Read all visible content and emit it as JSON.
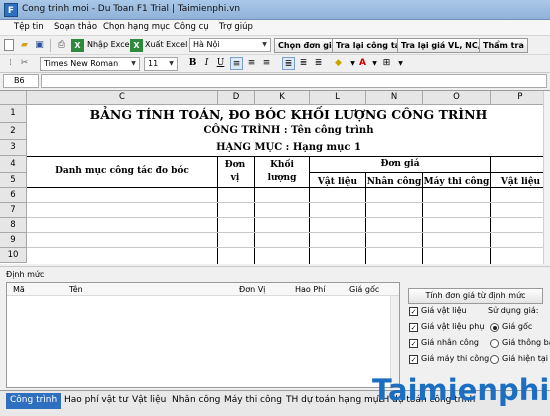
{
  "window": {
    "title": "Cong trinh moi - Du Toan F1 Trial | Taimienphi.vn",
    "app_icon": "F"
  },
  "menu": [
    "Tệp tin",
    "Soạn thảo",
    "Chọn hạng mục",
    "Công cụ",
    "Trợ giúp"
  ],
  "toolbar1": {
    "import_label": "Nhập Excel",
    "export_label": "Xuất Excel",
    "region": "Hà Nội",
    "btn_price": "Chọn đơn giá",
    "btn_check": "Tra lại công tác",
    "btn_check_price": "Tra lại giá VL, NC, M",
    "btn_review": "Thẩm tra"
  },
  "toolbar2": {
    "font": "Times New Roman",
    "size": "11"
  },
  "formula_bar": {
    "cell_ref": "B6",
    "value": ""
  },
  "grid": {
    "columns": [
      "C",
      "D",
      "K",
      "L",
      "N",
      "O",
      "P"
    ],
    "rows": [
      "1",
      "2",
      "3",
      "4",
      "5",
      "6",
      "7",
      "8",
      "9",
      "10"
    ],
    "title": "BẢNG TÍNH TOÁN, ĐO BÓC KHỐI LƯỢNG CÔNG TRÌNH",
    "project": "CÔNG TRÌNH : Tên công trình",
    "category": "HẠNG MỤC : Hạng mục 1",
    "h_item": "Danh mục công tác đo bóc",
    "h_unit": "Đơn vị",
    "h_qty": "Khối lượng",
    "h_price": "Đơn giá",
    "h_material": "Vật liệu",
    "h_labor": "Nhân công",
    "h_machine": "Máy thi công",
    "h_material2": "Vật liệu"
  },
  "norm_panel": {
    "label": "Định mức",
    "columns": [
      "Mã",
      "Tên",
      "Đơn Vị",
      "Hao Phí",
      "Giá gốc"
    ],
    "calc_button": "Tính đơn giá từ định mức",
    "checks": [
      {
        "label": "Giá vật liệu",
        "checked": true
      },
      {
        "label": "Giá vật liệu phụ",
        "checked": true
      },
      {
        "label": "Giá nhân công",
        "checked": true
      },
      {
        "label": "Giá máy thi công",
        "checked": true
      }
    ],
    "use_price_label": "Sử dụng giá:",
    "radios": [
      {
        "label": "Giá gốc",
        "selected": true
      },
      {
        "label": "Giá thông báo",
        "selected": false
      },
      {
        "label": "Giá hiện tại",
        "selected": false
      }
    ]
  },
  "tabs": [
    {
      "label": "Công trình",
      "active": true
    },
    {
      "label": "Hao phí vật tư",
      "active": false
    },
    {
      "label": "Vật liệu",
      "active": false
    },
    {
      "label": "Nhân công",
      "active": false
    },
    {
      "label": "Máy thi công",
      "active": false
    },
    {
      "label": "TH dự toán hạng mục",
      "active": false
    },
    {
      "label": "TH dự toán công trình",
      "active": false
    }
  ],
  "watermark": "Taimienphi"
}
